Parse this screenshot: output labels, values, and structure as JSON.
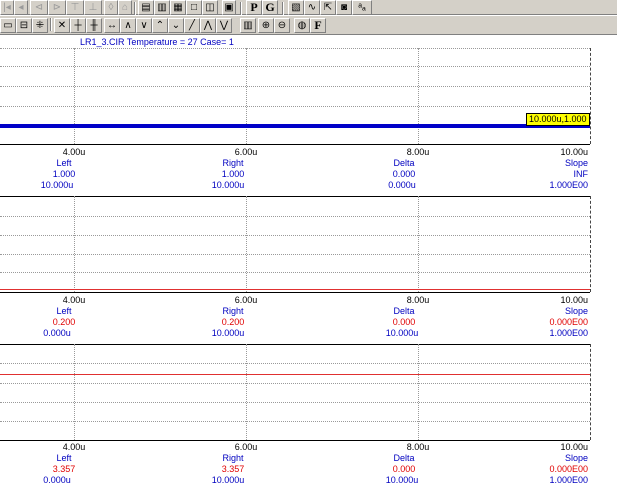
{
  "toolbar_top": {
    "items": [
      {
        "icon": "step-back-icon",
        "dim": true
      },
      {
        "icon": "arrow-left-icon",
        "dim": true
      },
      {
        "icon": "cursor-left-icon",
        "dim": true
      },
      {
        "icon": "cursor-right-icon",
        "dim": true
      },
      {
        "icon": "peak-icon",
        "dim": true
      },
      {
        "icon": "valley-icon",
        "dim": true
      },
      {
        "icon": "tile-icon",
        "dim": false
      },
      {
        "icon": "cascade-icon",
        "dim": false
      },
      {
        "icon": "stack-icon",
        "dim": false
      },
      {
        "icon": "window-icon",
        "dim": false
      },
      {
        "icon": "split-icon",
        "dim": false
      },
      {
        "icon": "calculator-icon",
        "dim": false
      },
      {
        "icon": "label-p",
        "text": "P"
      },
      {
        "icon": "label-g",
        "text": "G"
      },
      {
        "icon": "properties-icon",
        "dim": false
      },
      {
        "icon": "waveform-icon",
        "dim": false
      },
      {
        "icon": "cursor-mode-icon",
        "dim": false
      },
      {
        "icon": "save-icon",
        "dim": false
      },
      {
        "icon": "text-icon",
        "dim": false
      }
    ]
  },
  "toolbar_bottom": {
    "items": [
      {
        "icon": "scale-icon"
      },
      {
        "icon": "grid-icon"
      },
      {
        "icon": "dotted-grid-icon"
      },
      {
        "icon": "cursor-a-icon"
      },
      {
        "icon": "cursor-b-icon"
      },
      {
        "icon": "cursor-c-icon"
      },
      {
        "icon": "horizontal-marker-icon"
      },
      {
        "icon": "peak-wave-icon"
      },
      {
        "icon": "valley-wave-icon"
      },
      {
        "icon": "rise-wave-icon"
      },
      {
        "icon": "fall-wave-icon"
      },
      {
        "icon": "slope-icon"
      },
      {
        "icon": "peak-peak-icon"
      },
      {
        "icon": "valley-valley-icon"
      },
      {
        "icon": "bars-icon"
      },
      {
        "icon": "zoom-in-icon"
      },
      {
        "icon": "zoom-out-icon"
      },
      {
        "icon": "color-icon"
      },
      {
        "icon": "label-f",
        "text": "F"
      }
    ]
  },
  "plot_title": "LR1_3.CIR Temperature = 27 Case= 1",
  "panels": [
    {
      "tag": "10.000u,1.000",
      "x_ticks": [
        "4.00u",
        "6.00u",
        "8.00u",
        "10.00u"
      ],
      "readout_headers": [
        "Left",
        "Right",
        "Delta",
        "Slope"
      ],
      "values_row1": [
        "1.000",
        "1.000",
        "0.000",
        "INF"
      ],
      "values_row2": [
        "10.000u",
        "10.000u",
        "0.000u",
        "1.000E00"
      ],
      "row1_color": "#0000c0"
    },
    {
      "x_ticks": [
        "4.00u",
        "6.00u",
        "8.00u",
        "10.00u"
      ],
      "readout_headers": [
        "Left",
        "Right",
        "Delta",
        "Slope"
      ],
      "values_row1": [
        "0.200",
        "0.200",
        "0.000",
        "0.000E00"
      ],
      "values_row2": [
        "0.000u",
        "10.000u",
        "10.000u",
        "1.000E00"
      ],
      "row1_color": "#e00000"
    },
    {
      "x_ticks": [
        "4.00u",
        "6.00u",
        "8.00u",
        "10.00u"
      ],
      "readout_headers": [
        "Left",
        "Right",
        "Delta",
        "Slope"
      ],
      "values_row1": [
        "3.357",
        "3.357",
        "0.000",
        "0.000E00"
      ],
      "values_row2": [
        "0.000u",
        "10.000u",
        "10.000u",
        "1.000E00"
      ],
      "row1_color": "#e00000"
    }
  ],
  "colors": {
    "trace_blue": "#0000c8",
    "trace_red": "#e03030",
    "label_blue": "#0000c0",
    "label_red": "#e00000",
    "tag_bg": "#ffff00"
  }
}
